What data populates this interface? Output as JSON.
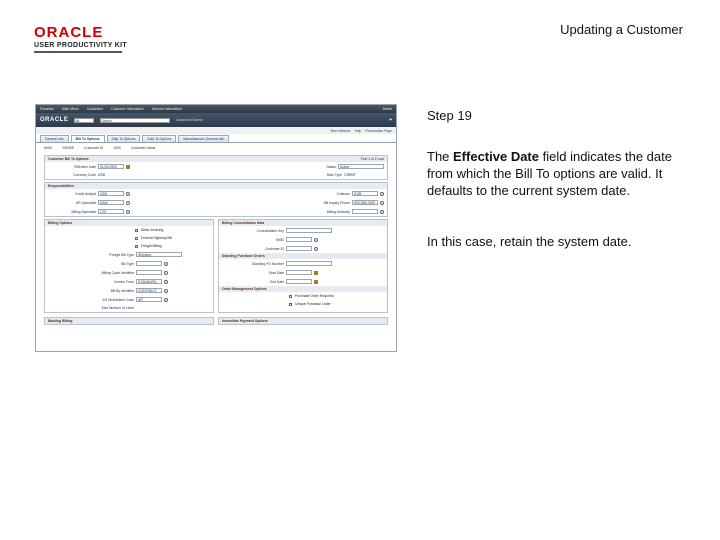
{
  "header": {
    "logo_brand": "ORACLE",
    "logo_sub": "USER PRODUCTIVITY KIT",
    "doc_title": "Updating a Customer"
  },
  "app": {
    "menu": [
      "Favorites",
      "Main Menu",
      "Customers",
      "Customer Information",
      "General Information"
    ],
    "home": "Home",
    "brand": "ORACLE",
    "search_scope": "All",
    "search_placeholder": "Search",
    "advanced_search": "Advanced Search",
    "toolbar": [
      "New Window",
      "Help",
      "Personalize Page"
    ],
    "tabs": [
      "General Info",
      "Bill To Options",
      "Ship To Options",
      "Sold To Options",
      "Miscellaneous General Info"
    ],
    "active_tab_index": 1,
    "summary": {
      "setid_label": "SetID",
      "setid_value": "SHARE",
      "customer_id_label": "Customer ID",
      "customer_id_value": "1000",
      "customer_name": "Customer Name"
    },
    "bill_to": {
      "title": "Customer Bill To Options",
      "nav": "First  1 of 2  Last",
      "effective_date_label": "*Effective Date",
      "effective_date_value": "01/01/1900",
      "status_label": "Status",
      "status_value": "Active",
      "currency_code_label": "Currency Code",
      "currency_code_value": "USD",
      "rate_type_label": "Rate Type",
      "rate_type_value": "CRRNT"
    },
    "responsibilities": {
      "title": "Responsibilities",
      "credit_analyst_label": "Credit Analyst",
      "credit_analyst_value": "CBS",
      "collector_label": "Collector",
      "collector_value": "DOB",
      "ar_specialist_label": "AR Specialist",
      "ar_specialist_value": "KAW",
      "bill_inquiry_label": "Bill Inquiry Phone",
      "bill_inquiry_value": "800-555-0000",
      "billing_specialist_label": "Billing Specialist",
      "billing_specialist_value": "CST",
      "billing_authority_label": "Billing Authority"
    },
    "billing_options": {
      "title": "Billing Options",
      "allow_invoicing": "Allow Invoicing",
      "federal_highway": "Federal Highway Bill",
      "freight_billing": "Freight Billing",
      "freight_bill_type_label": "*Freight Bill Type",
      "freight_bill_type_value": "Shipping",
      "bill_type_label": "Bill Type",
      "billing_cycle_label": "Billing Cycle Identifier",
      "invoice_form_label": "Invoice Form",
      "invoice_form_value": "STANDARD",
      "bill_by_label": "Bill By Identifier",
      "bill_by_value": "CONTRACT",
      "ar_dist_label": "AR Distribution Code",
      "ar_dist_value": "AR",
      "max_invoices_label": "Max Number of Lines"
    },
    "consolidate": {
      "title": "Billing Consolidation Data",
      "consolidation_key_label": "Consolidation Key",
      "setid_label": "SetID",
      "customer_label": "Customer ID"
    },
    "purchase_orders": {
      "title": "Standing Purchase Orders",
      "po_number_label": "Standing PO Number",
      "start_date_label": "Start Date",
      "end_date_label": "End Date"
    },
    "order_management": {
      "title": "Order Management Options",
      "po_required": "Purchase Order Required",
      "unique_po": "Unique Purchase Order"
    },
    "bottom_left_title": "Backlog Billing",
    "bottom_right_title": "Immediate Payment Options"
  },
  "step": {
    "title": "Step 19",
    "desc_prefix": "The ",
    "desc_bold": "Effective Date",
    "desc_suffix": " field indicates the date from which the Bill To options are valid. It defaults to the current system date.",
    "note": "In this case, retain the system date."
  }
}
